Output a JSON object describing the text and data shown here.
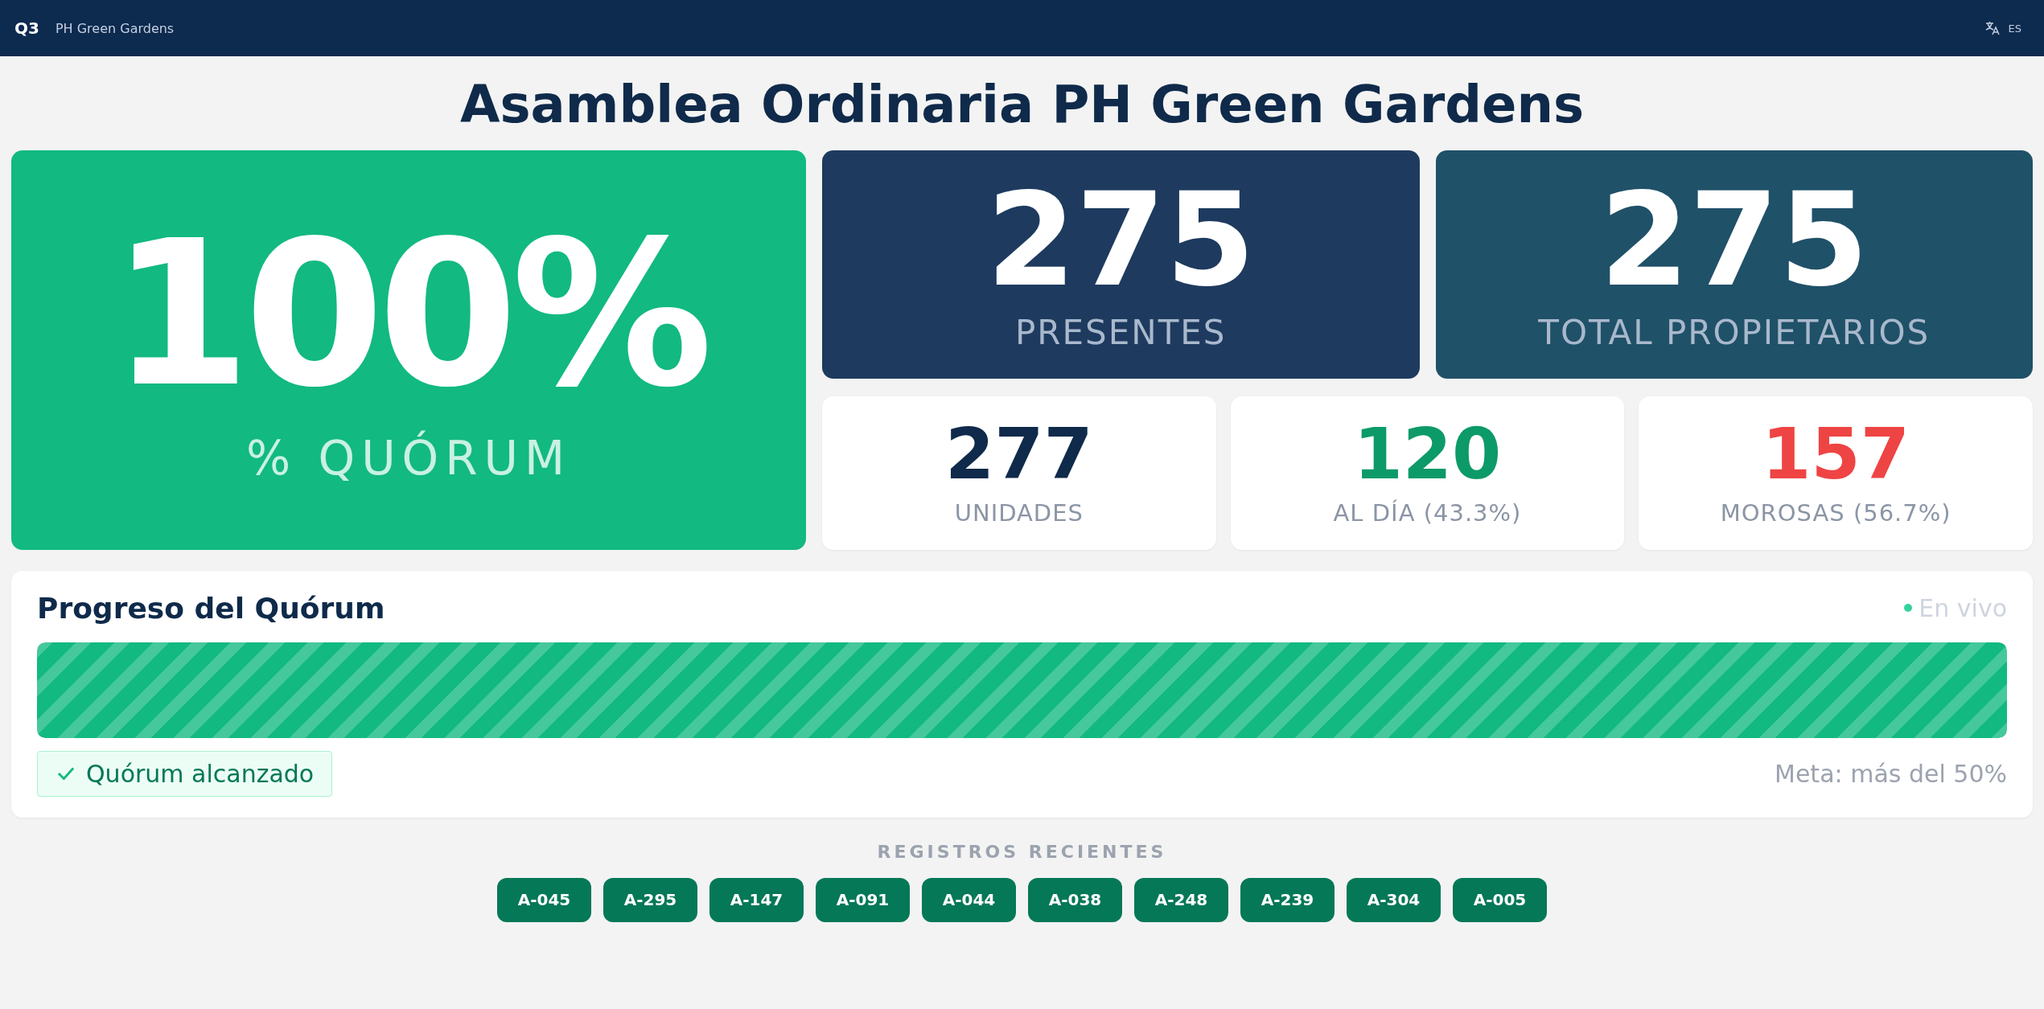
{
  "top_bar": {
    "logo": "Q3",
    "name": "PH Green Gardens",
    "language": "ES"
  },
  "title": "Asamblea Ordinaria PH Green Gardens",
  "quorum": {
    "value": "100%",
    "label": "% QUÓRUM"
  },
  "main_stats": [
    {
      "value": "275",
      "label": "PRESENTES",
      "color": "#1e3a5f"
    },
    {
      "value": "275",
      "label": "TOTAL PROPIETARIOS",
      "color": "#1f5168"
    }
  ],
  "small_stats": [
    {
      "value": "277",
      "label": "UNIDADES",
      "color": "#0f2a4a"
    },
    {
      "value": "120",
      "label": "AL DÍA (43.3%)",
      "color": "#0c9a68"
    },
    {
      "value": "157",
      "label": "MOROSAS (56.7%)",
      "color": "#ef4444"
    }
  ],
  "progress": {
    "title": "Progreso del Quórum",
    "live": "En vivo",
    "level": 1.0,
    "reached": true,
    "status": "Quórum alcanzado",
    "goal": "Meta: más del 50%"
  },
  "recent": {
    "title": "REGISTROS RECIENTES",
    "items": [
      "A-045",
      "A-295",
      "A-147",
      "A-091",
      "A-044",
      "A-038",
      "A-248",
      "A-239",
      "A-304",
      "A-005"
    ]
  }
}
